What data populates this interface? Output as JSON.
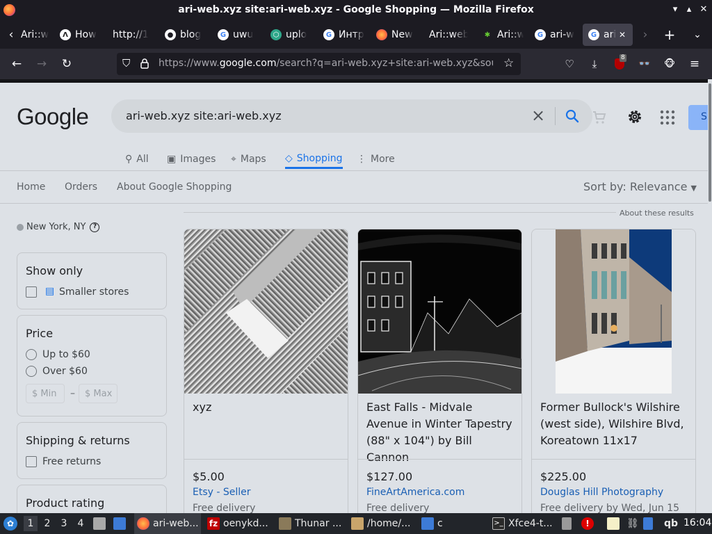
{
  "window": {
    "title": "ari-web.xyz site:ari-web.xyz - Google Shopping — Mozilla Firefox"
  },
  "tabs": [
    {
      "label": "Ari::w",
      "icon": "ari-favicon"
    },
    {
      "label": "How",
      "icon": "how-favicon"
    },
    {
      "label": "http://1",
      "icon": "blank-favicon"
    },
    {
      "label": "blog",
      "icon": "github-icon"
    },
    {
      "label": "uwu",
      "icon": "google-icon"
    },
    {
      "label": "uplo",
      "icon": "upload-favicon"
    },
    {
      "label": "Интр",
      "icon": "google-icon"
    },
    {
      "label": "New",
      "icon": "firefox-icon"
    },
    {
      "label": "Ari::web",
      "icon": "blank-favicon"
    },
    {
      "label": "Ari::w",
      "icon": "ari-favicon"
    },
    {
      "label": "ari-w",
      "icon": "google-icon"
    },
    {
      "label": "ari",
      "icon": "google-icon"
    }
  ],
  "urlbar": {
    "prefix": "https://www.",
    "domain": "google.com",
    "rest": "/search?q=ari-web.xyz+site:ari-web.xyz&sou"
  },
  "toolbar": {
    "ublock_badge": "8"
  },
  "google": {
    "logo": "Google",
    "query": "ari-web.xyz site:ari-web.xyz",
    "signin": "Si",
    "nav_tabs": [
      {
        "label": "All",
        "icon": "search-icon"
      },
      {
        "label": "Images",
        "icon": "image-icon"
      },
      {
        "label": "Maps",
        "icon": "map-pin-icon"
      },
      {
        "label": "Shopping",
        "icon": "tag-icon"
      },
      {
        "label": "More",
        "icon": "kebab-icon"
      }
    ],
    "subnav": [
      "Home",
      "Orders",
      "About Google Shopping"
    ],
    "sort": "Sort by: Relevance",
    "about": "About these results",
    "location": "New York, NY",
    "filters": {
      "show_only": {
        "title": "Show only",
        "option": "Smaller stores"
      },
      "price": {
        "title": "Price",
        "options": [
          "Up to $60",
          "Over $60"
        ],
        "min_placeholder": "$ Min",
        "dash": "–",
        "max_placeholder": "$ Max"
      },
      "shipping": {
        "title": "Shipping & returns",
        "option": "Free returns"
      },
      "rating": {
        "title": "Product rating"
      }
    },
    "products": [
      {
        "title": "xyz",
        "price": "$5.00",
        "seller": "Etsy - Seller",
        "delivery": "Free delivery"
      },
      {
        "title": "East Falls - Midvale Avenue in Winter Tapestry (88\" x 104\") by Bill Cannon",
        "price": "$127.00",
        "seller": "FineArtAmerica.com",
        "delivery": "Free delivery"
      },
      {
        "title": "Former Bullock's Wilshire (west side), Wilshire Blvd, Koreatown 11x17",
        "price": "$225.00",
        "seller": "Douglas Hill Photography",
        "delivery": "Free delivery by Wed, Jun 15"
      }
    ]
  },
  "taskbar": {
    "workspaces": [
      "1",
      "2",
      "3",
      "4"
    ],
    "apps": [
      {
        "label": "ari-web...",
        "icon": "firefox-icon"
      },
      {
        "label": "oenykd...",
        "icon": "filezilla-icon"
      },
      {
        "label": "Thunar ...",
        "icon": "folder-icon"
      },
      {
        "label": "/home/...",
        "icon": "archive-icon"
      },
      {
        "label": "c",
        "icon": "window-icon"
      },
      {
        "label": "Xfce4-t...",
        "icon": "terminal-icon"
      }
    ],
    "tray_text": "qb",
    "clock": "16:04"
  }
}
